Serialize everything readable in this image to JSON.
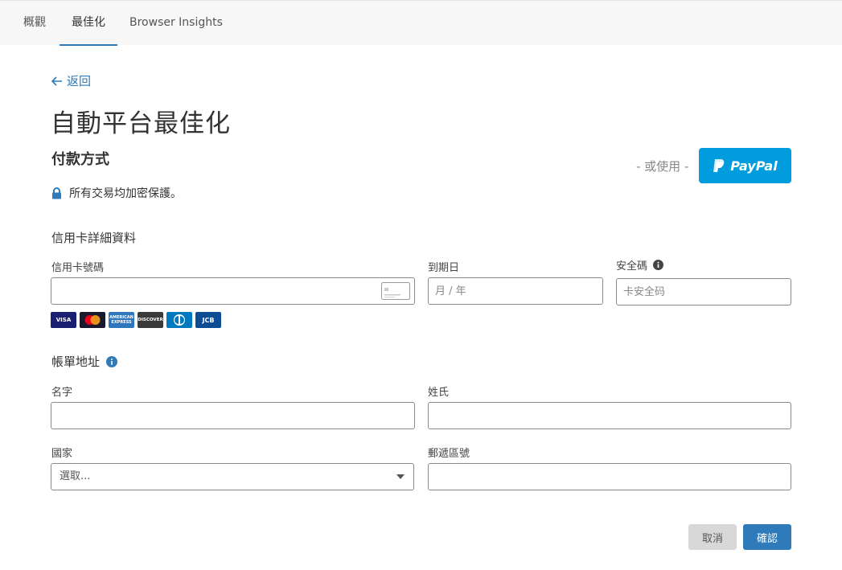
{
  "tabs": [
    {
      "label": "概觀"
    },
    {
      "label": "最佳化"
    },
    {
      "label": "Browser Insights"
    }
  ],
  "back_label": "返回",
  "page_title": "自動平台最佳化",
  "payment": {
    "title": "付款方式",
    "or_use": "- 或使用 -",
    "paypal_label": "PayPal",
    "secure_note": "所有交易均加密保護。"
  },
  "card": {
    "heading": "信用卡詳細資料",
    "number_label": "信用卡號碼",
    "expiry_label": "到期日",
    "expiry_placeholder": "月 / 年",
    "cvc_label": "安全碼",
    "cvc_placeholder": "卡安全码",
    "logos": [
      {
        "name": "visa",
        "text": "VISA",
        "color": "#1a1f71"
      },
      {
        "name": "mastercard",
        "text": "",
        "color": "#1a1a2e"
      },
      {
        "name": "amex",
        "text": "AMERICAN EXPRESS",
        "color": "#2e77bc"
      },
      {
        "name": "discover",
        "text": "DISCOVER",
        "color": "#3a3a3a"
      },
      {
        "name": "diners",
        "text": "",
        "color": "#0079be"
      },
      {
        "name": "jcb",
        "text": "JCB",
        "color": "#0e4c96"
      }
    ]
  },
  "billing": {
    "heading": "帳單地址",
    "first_name_label": "名字",
    "last_name_label": "姓氏",
    "country_label": "國家",
    "country_value": "選取...",
    "postal_label": "郵遞區號"
  },
  "actions": {
    "cancel": "取消",
    "confirm": "確認"
  },
  "colors": {
    "accent": "#2f7ab8",
    "paypal": "#009cde"
  }
}
